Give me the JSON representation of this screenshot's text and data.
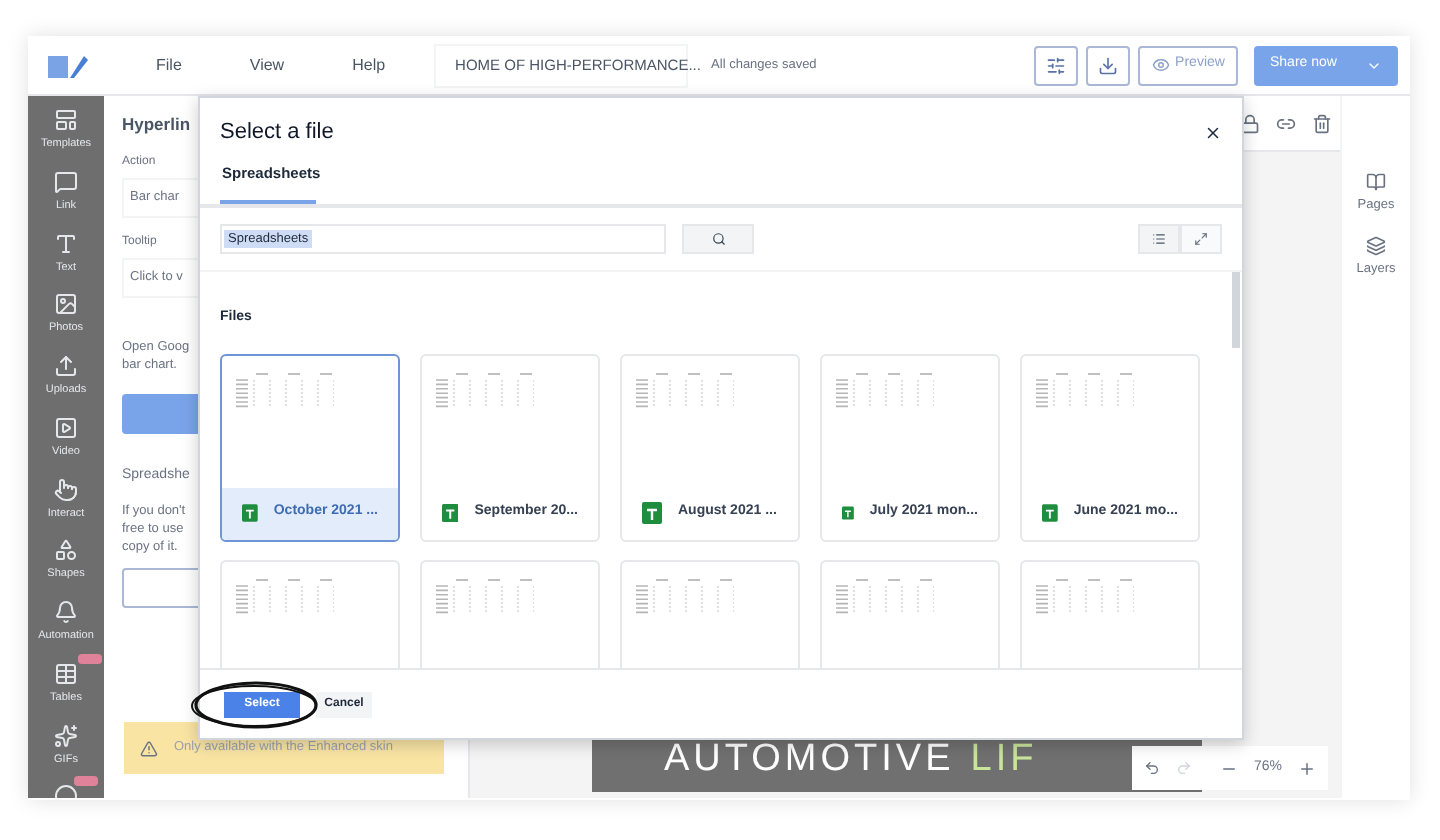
{
  "topbar": {
    "menu": [
      "File",
      "View",
      "Help"
    ],
    "doc_title": "HOME OF HIGH-PERFORMANCE...",
    "save_status": "All changes saved",
    "preview": "Preview",
    "share": "Share now"
  },
  "sidebar": {
    "items": [
      {
        "kind": "templates",
        "label": "Templates",
        "badge": false
      },
      {
        "kind": "link",
        "label": "Link",
        "badge": false
      },
      {
        "kind": "text",
        "label": "Text",
        "badge": false
      },
      {
        "kind": "photos",
        "label": "Photos",
        "badge": false
      },
      {
        "kind": "uploads",
        "label": "Uploads",
        "badge": false
      },
      {
        "kind": "video",
        "label": "Video",
        "badge": false
      },
      {
        "kind": "interact",
        "label": "Interact",
        "badge": false
      },
      {
        "kind": "shapes",
        "label": "Shapes",
        "badge": false
      },
      {
        "kind": "automation",
        "label": "Automation",
        "badge": false
      },
      {
        "kind": "tables",
        "label": "Tables",
        "badge": true
      },
      {
        "kind": "gifs",
        "label": "GIFs",
        "badge": false
      },
      {
        "kind": "more",
        "badge": true
      }
    ]
  },
  "panel": {
    "title": "Hyperlin",
    "fields": [
      {
        "label": "Action",
        "value": "Bar char"
      },
      {
        "label": "Tooltip",
        "value": "Click to v"
      }
    ],
    "note": [
      "Open Goog",
      "bar chart."
    ],
    "section": "Spreadshe",
    "section_note": [
      "If you don't",
      "free to use",
      "copy of it."
    ],
    "warning": "Only available with the Enhanced skin"
  },
  "canvas": {
    "headline": "AUTOMOTIVE",
    "headline_accent": "LIF",
    "zoom": "76%"
  },
  "right_panel": {
    "items": [
      {
        "kind": "pages",
        "label": "Pages"
      },
      {
        "kind": "layers",
        "label": "Layers"
      }
    ]
  },
  "dialog": {
    "title": "Select a file",
    "tabs": [
      {
        "label": "Spreadsheets",
        "selected": true
      }
    ],
    "search": {
      "value": "Spreadsheets"
    },
    "section": "Files",
    "files": [
      {
        "name": "October 2021 ...",
        "selected": true
      },
      {
        "name": "September 20...",
        "selected": false
      },
      {
        "name": "August 2021 ...",
        "selected": false
      },
      {
        "name": "July 2021 mon...",
        "selected": false
      },
      {
        "name": "June 2021 mo...",
        "selected": false
      },
      {
        "selected": false
      },
      {
        "selected": false
      },
      {
        "selected": false
      },
      {
        "selected": false
      },
      {
        "selected": false
      }
    ],
    "buttons": {
      "primary": "Select",
      "secondary": "Cancel"
    }
  }
}
